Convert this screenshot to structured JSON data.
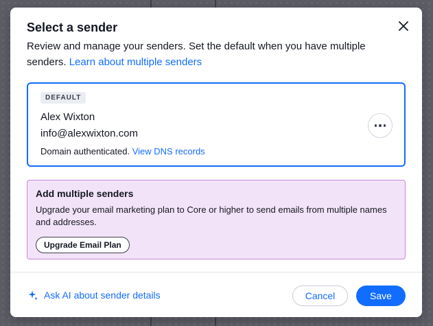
{
  "colors": {
    "accent": "#116dff",
    "upgrade_background": "#f3e3f8",
    "upgrade_border": "#c889de"
  },
  "dialog": {
    "title": "Select a sender",
    "subtitle": "Review and manage your senders. Set the default when you have multiple senders.",
    "subtitle_link": "Learn about multiple senders",
    "close_icon": "close-icon"
  },
  "sender": {
    "badge": "DEFAULT",
    "name": "Alex Wixton",
    "email": "info@alexwixton.com",
    "domain_status": "Domain authenticated.",
    "domain_link": "View DNS records",
    "more_icon": "more-horizontal-icon"
  },
  "upgrade": {
    "title": "Add multiple senders",
    "text": "Upgrade your email marketing plan to Core or higher to send emails from multiple names and addresses.",
    "button_label": "Upgrade Email Plan"
  },
  "footer": {
    "ai_link": "Ask AI about sender details",
    "ai_icon": "sparkle-icon",
    "cancel_label": "Cancel",
    "save_label": "Save"
  }
}
